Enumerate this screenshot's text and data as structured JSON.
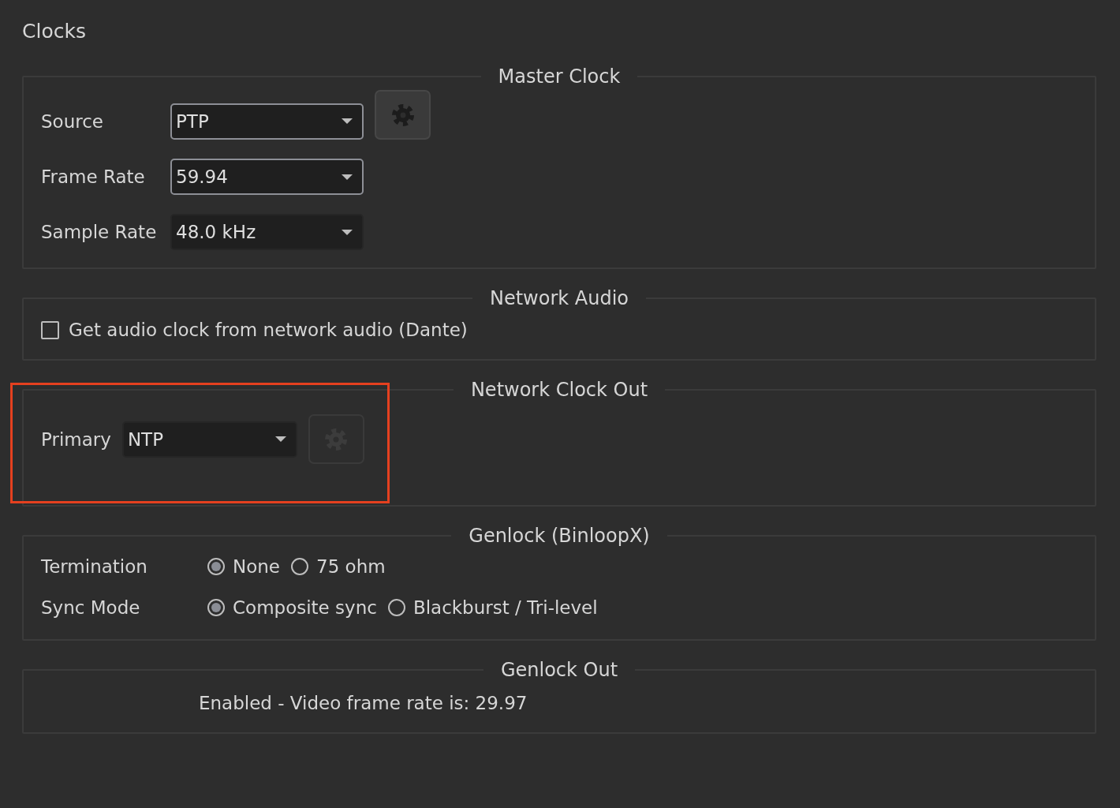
{
  "title": "Clocks",
  "sections": [
    {
      "kind": "form",
      "legend": "Master Clock",
      "rows": [
        {
          "label": "Source",
          "dropdown": {
            "value": "PTP",
            "outlined": true
          },
          "settings_button": {
            "disabled": false
          }
        },
        {
          "label": "Frame Rate",
          "dropdown": {
            "value": "59.94",
            "outlined": true
          }
        },
        {
          "label": "Sample Rate",
          "dropdown": {
            "value": "48.0 kHz",
            "outlined": false
          }
        }
      ]
    },
    {
      "kind": "checkbox",
      "legend": "Network Audio",
      "checkbox": {
        "label": "Get audio clock from network audio (Dante)",
        "checked": false
      }
    },
    {
      "kind": "form",
      "legend": "Network Clock Out",
      "highlighted": true,
      "rows": [
        {
          "label": "Primary",
          "dropdown": {
            "value": "NTP",
            "outlined": false
          },
          "settings_button": {
            "disabled": true
          }
        }
      ]
    },
    {
      "kind": "radios",
      "legend": "Genlock (BinloopX)",
      "rows": [
        {
          "label": "Termination",
          "options": [
            {
              "label": "None",
              "selected": true
            },
            {
              "label": "75 ohm",
              "selected": false
            }
          ]
        },
        {
          "label": "Sync Mode",
          "options": [
            {
              "label": "Composite sync",
              "selected": true
            },
            {
              "label": "Blackburst / Tri-level",
              "selected": false
            }
          ]
        }
      ]
    },
    {
      "kind": "text",
      "legend": "Genlock Out",
      "text": "Enabled - Video frame rate is: 29.97"
    }
  ]
}
